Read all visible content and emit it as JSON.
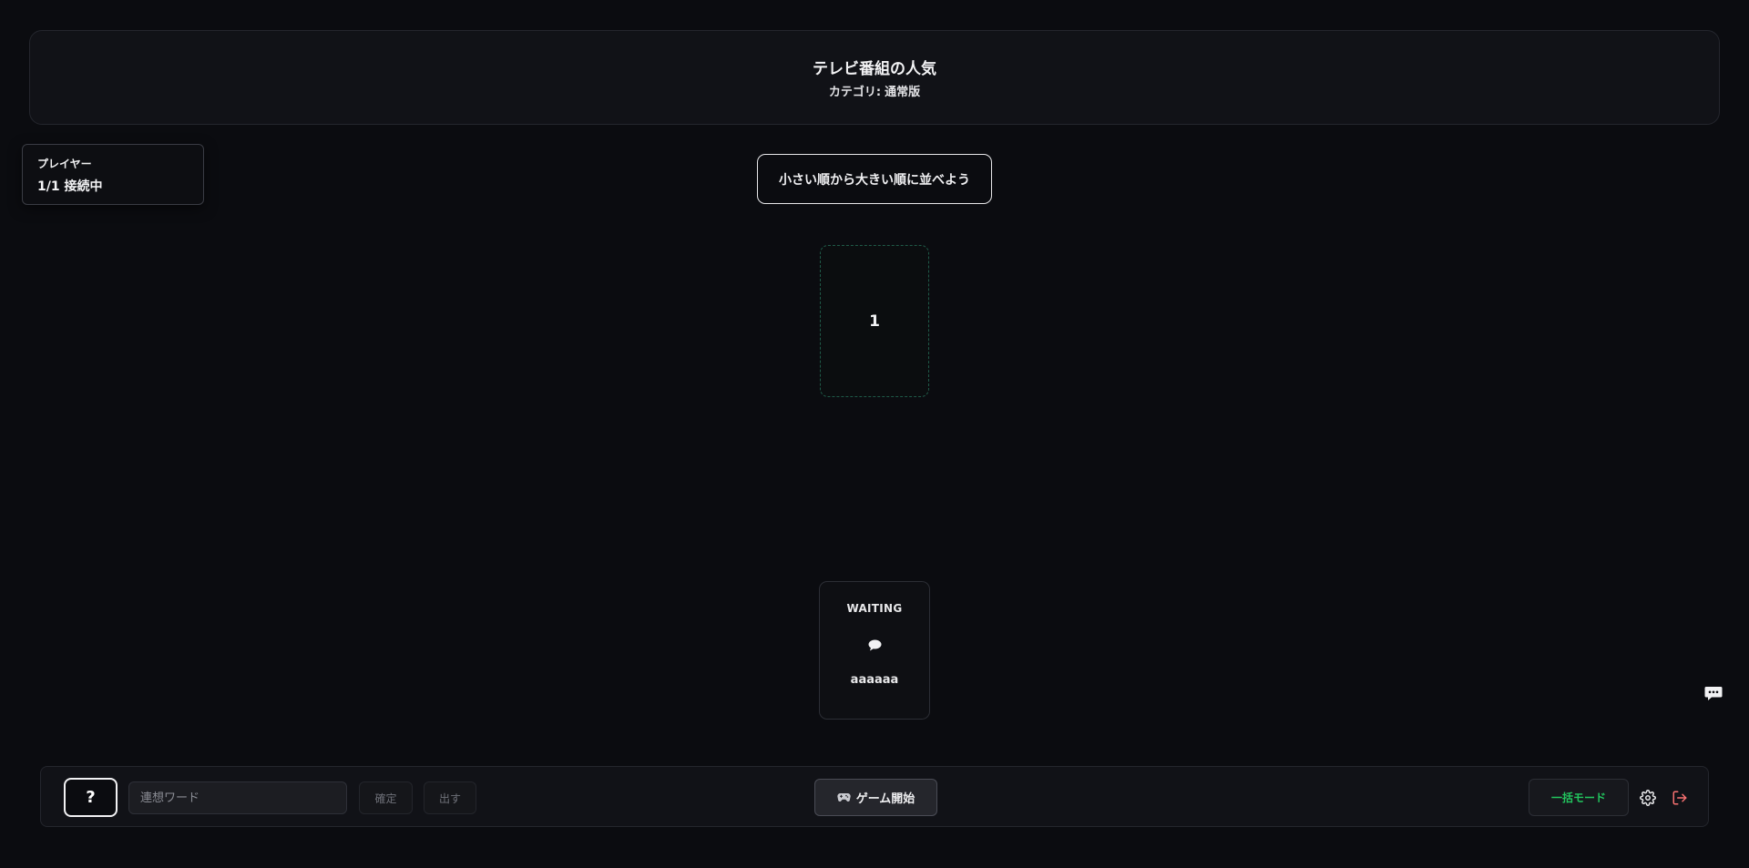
{
  "topic": {
    "title": "テレビ番組の人気",
    "category_label": "カテゴリ:",
    "category_value": "通常版"
  },
  "players": {
    "label": "プレイヤー",
    "status": "1/1 接続中"
  },
  "instruction": "小さい順から大きい順に並べよう",
  "slot": {
    "number": "1"
  },
  "hand_card": {
    "status": "WAITING",
    "icon": "speech-bubble-icon",
    "player_name": "aaaaaa"
  },
  "toolbar": {
    "help_label": "?",
    "word_input": {
      "placeholder": "連想ワード",
      "value": ""
    },
    "confirm_label": "確定",
    "play_label": "出す",
    "start_icon": "gamepad-icon",
    "start_label": "ゲーム開始",
    "bulk_mode_label": "一括モード",
    "settings_icon": "gear-icon",
    "exit_icon": "logout-icon"
  },
  "chat_fab": {
    "icon": "chat-icon"
  },
  "colors": {
    "background": "#0b0c10",
    "accent_green": "#22c55e",
    "exit_red": "#f87171",
    "slot_border": "#1f5a48"
  }
}
